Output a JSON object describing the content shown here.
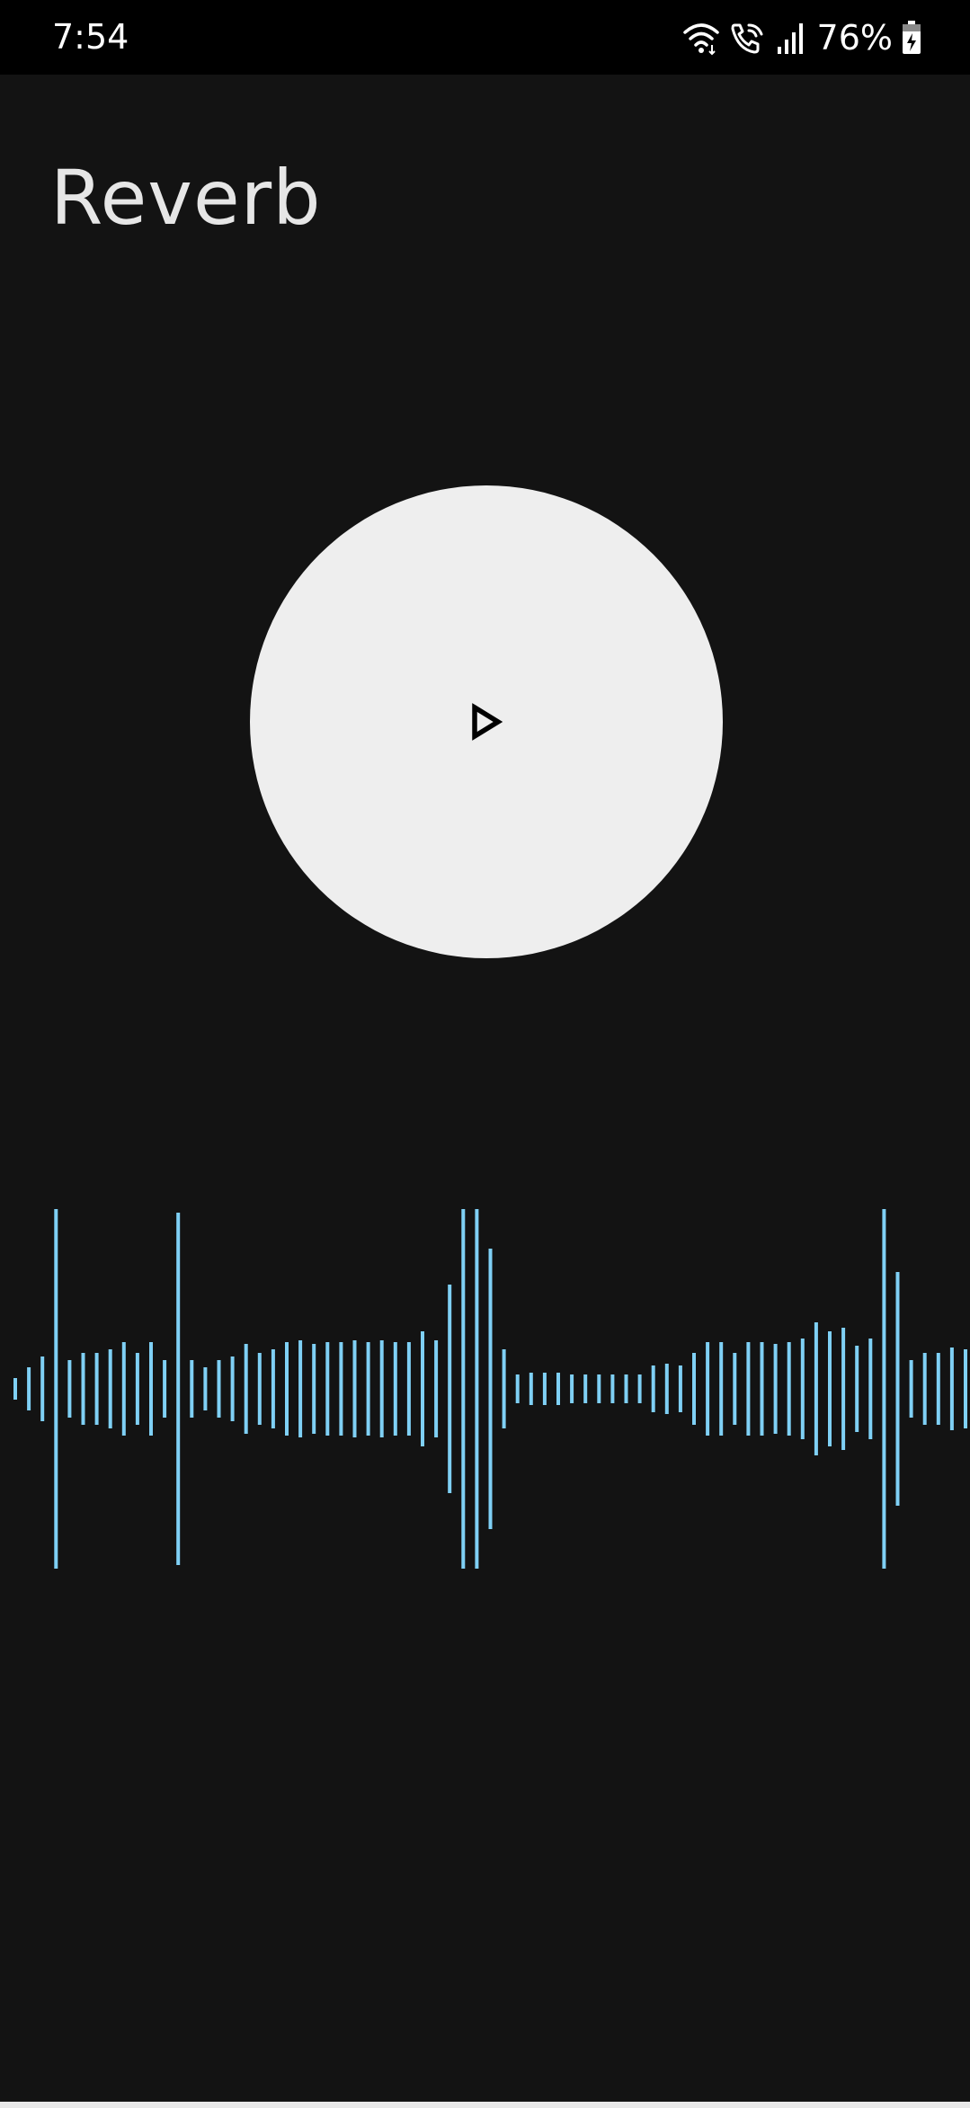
{
  "status_bar": {
    "time": "7:54",
    "battery_percent": "76%",
    "icons": [
      "wifi-icon",
      "wifi-calling-icon",
      "signal-icon",
      "battery-charging-icon"
    ]
  },
  "app": {
    "title": "Reverb"
  },
  "player": {
    "play_icon": "play-outline-icon",
    "button_color": "#eeeeee",
    "icon_color": "#000000"
  },
  "waveform": {
    "color": "#7fd0f5",
    "levels": [
      0.06,
      0.12,
      0.18,
      1.0,
      0.16,
      0.2,
      0.2,
      0.22,
      0.26,
      0.2,
      0.26,
      0.16,
      0.98,
      0.16,
      0.12,
      0.16,
      0.18,
      0.25,
      0.2,
      0.22,
      0.26,
      0.27,
      0.25,
      0.26,
      0.26,
      0.27,
      0.26,
      0.27,
      0.26,
      0.26,
      0.32,
      0.27,
      0.58,
      1.0,
      1.0,
      0.78,
      0.22,
      0.08,
      0.09,
      0.09,
      0.09,
      0.08,
      0.08,
      0.08,
      0.08,
      0.08,
      0.08,
      0.13,
      0.14,
      0.13,
      0.2,
      0.26,
      0.26,
      0.2,
      0.26,
      0.26,
      0.25,
      0.26,
      0.28,
      0.37,
      0.32,
      0.34,
      0.24,
      0.28,
      1.0,
      0.65,
      0.16,
      0.2,
      0.2,
      0.23,
      0.22
    ]
  }
}
